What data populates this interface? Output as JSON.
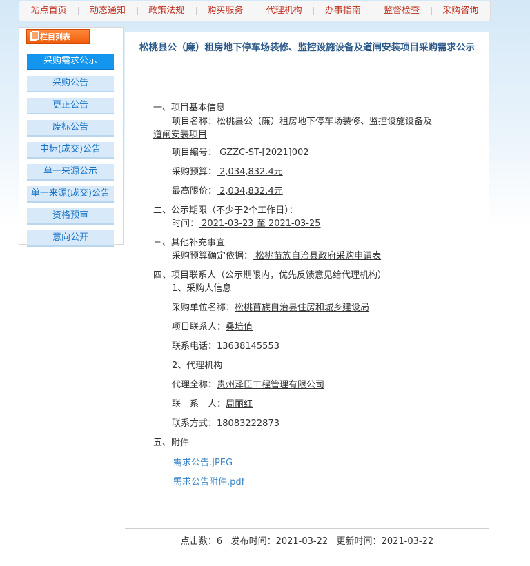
{
  "nav": [
    "站点首页",
    "动态通知",
    "政策法规",
    "购买服务",
    "代理机构",
    "办事指南",
    "监督检查",
    "采购咨询"
  ],
  "sidebar": {
    "header": "栏目列表",
    "items": [
      "采购需求公示",
      "采购公告",
      "更正公告",
      "废标公告",
      "中标(成交)公告",
      "单一来源公示",
      "单一来源(成交)公告",
      "资格预审",
      "意向公开"
    ],
    "active_index": 0
  },
  "article": {
    "title": "松桃县公（廉）租房地下停车场装修、监控设施设备及道闸安装项目采购需求公示",
    "s1_heading": "一、项目基本信息",
    "s1_name_label": "项目名称：",
    "s1_name_line1": "松桃县公（廉）租房地下停车场装修、监控设施设备及",
    "s1_name_line2": "道闸安装项目",
    "s1_code_label": "项目编号：",
    "s1_code": " GZZC-ST-[2021]002",
    "s1_budget_label": "采购预算：",
    "s1_budget": " 2,034,832.4元",
    "s1_max_label": "最高限价：",
    "s1_max": " 2,034,832.4元",
    "s2_heading": "二、公示期限（不少于2个工作日）：",
    "s2_time_label": "时间：",
    "s2_time": " 2021-03-23 至 2021-03-25",
    "s3_heading": "三、其他补充事宜",
    "s3_basis_label": "采购预算确定依据：",
    "s3_basis": " 松桃苗族自治县政府采购申请表",
    "s4_heading": "四、项目联系人（公示期限内，优先反馈意见给代理机构）",
    "s4_sub1": "1、采购人信息",
    "s4_unit_label": "采购单位名称：",
    "s4_unit": "松桃苗族自治县住房和城乡建设局",
    "s4_contact_label": "项目联系人：",
    "s4_contact": "桑培值",
    "s4_phone_label": "联系电话：",
    "s4_phone": "13638145553",
    "s4_sub2": "2、代理机构",
    "s4_agent_label": "代理全称：",
    "s4_agent": "贵州泽臣工程管理有限公司",
    "s4_agent_contact_label": "联　系　人：",
    "s4_agent_contact": "周丽红",
    "s4_agent_phone_label": "联系方式：",
    "s4_agent_phone": "18083222873",
    "s5_heading": "五、附件",
    "attachments": [
      "需求公告.JPEG",
      "需求公告附件.pdf"
    ]
  },
  "footer": {
    "clicks_label": "点击数：",
    "clicks": "6",
    "publish_label": "发布时间：",
    "publish": "2021-03-22",
    "update_label": "更新时间：",
    "update": "2021-03-22"
  },
  "colors": {
    "nav_text": "#c0311f",
    "sidebar_active": "#1596ee",
    "sidebar_item": "#d8eafa",
    "sidebar_header": "#ef5b0a",
    "title": "#2b5a8a",
    "link": "#3a86c8"
  }
}
